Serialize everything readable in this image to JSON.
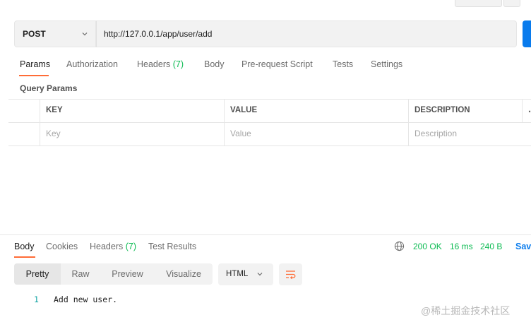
{
  "request": {
    "method": "POST",
    "url": "http://127.0.0.1/app/user/add"
  },
  "request_tabs": [
    {
      "label": "Params",
      "active": true
    },
    {
      "label": "Authorization"
    },
    {
      "label": "Headers",
      "count": "(7)"
    },
    {
      "label": "Body"
    },
    {
      "label": "Pre-request Script"
    },
    {
      "label": "Tests"
    },
    {
      "label": "Settings"
    }
  ],
  "query_params": {
    "title": "Query Params",
    "headers": [
      "KEY",
      "VALUE",
      "DESCRIPTION"
    ],
    "placeholders": [
      "Key",
      "Value",
      "Description"
    ],
    "more_icon": "more-icon"
  },
  "response": {
    "tabs": [
      {
        "label": "Body",
        "active": true
      },
      {
        "label": "Cookies"
      },
      {
        "label": "Headers",
        "count": "(7)"
      },
      {
        "label": "Test Results"
      }
    ],
    "status": "200 OK",
    "time": "16 ms",
    "size": "240 B",
    "save_label": "Save",
    "view_modes": [
      "Pretty",
      "Raw",
      "Preview",
      "Visualize"
    ],
    "format": "HTML",
    "code": {
      "line": "1",
      "text": "Add new user."
    }
  },
  "watermark": "@稀土掘金技术社区",
  "colors": {
    "accent": "#ff6c37",
    "success": "#0cbb52",
    "primary": "#097bed"
  }
}
